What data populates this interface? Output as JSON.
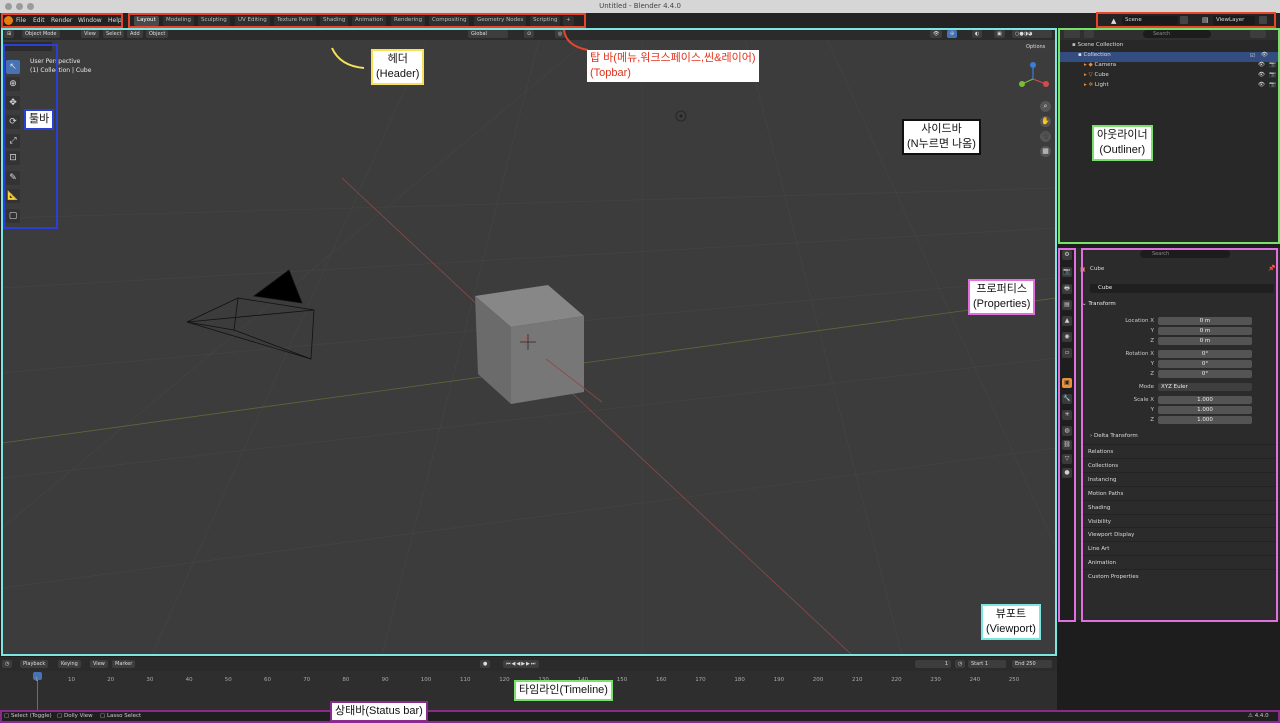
{
  "window": {
    "title": "Untitled - Blender 4.4.0"
  },
  "topbar": {
    "menus": [
      "File",
      "Edit",
      "Render",
      "Window",
      "Help"
    ],
    "workspaces": [
      "Layout",
      "Modeling",
      "Sculpting",
      "UV Editing",
      "Texture Paint",
      "Shading",
      "Animation",
      "Rendering",
      "Compositing",
      "Geometry Nodes",
      "Scripting"
    ],
    "add_tab": "+",
    "scene": "Scene",
    "view_layer": "ViewLayer"
  },
  "viewport_header": {
    "mode": "Object Mode",
    "menus": [
      "View",
      "Select",
      "Add",
      "Object"
    ],
    "orientation": "Global",
    "options": "Options"
  },
  "viewport": {
    "perspective": "User Perspective",
    "collection_info": "(1) Collection | Cube"
  },
  "annotations": {
    "header": "헤더\n(Header)",
    "topbar": "탑 바(메뉴,워크스페이스,씬&레이어)\n(Topbar)",
    "toolbar": "툴바",
    "sidebar": "사이드바\n(N누르면 나옴)",
    "outliner": "아웃라이너\n(Outliner)",
    "properties": "프로퍼티스\n(Properties)",
    "viewport": "뷰포트\n(Viewport)",
    "timeline": "타임라인(Timeline)",
    "statusbar": "상태바(Status bar)"
  },
  "outliner": {
    "search_placeholder": "Search",
    "root": "Scene Collection",
    "collection": "Collection",
    "items": [
      "Camera",
      "Cube",
      "Light"
    ]
  },
  "properties": {
    "search_placeholder": "Search",
    "object_name": "Cube",
    "object_field": "Cube",
    "transform_title": "Transform",
    "location_label": "Location X",
    "rotation_label": "Rotation X",
    "scale_label": "Scale X",
    "mode_label": "Mode",
    "location": [
      "0 m",
      "0 m",
      "0 m"
    ],
    "rotation": [
      "0°",
      "0°",
      "0°"
    ],
    "mode_value": "XYZ Euler",
    "scale": [
      "1.000",
      "1.000",
      "1.000"
    ],
    "axis_y": "Y",
    "axis_z": "Z",
    "delta": "Delta Transform",
    "panels": [
      "Relations",
      "Collections",
      "Instancing",
      "Motion Paths",
      "Shading",
      "Visibility",
      "Viewport Display",
      "Line Art",
      "Animation",
      "Custom Properties"
    ]
  },
  "timeline": {
    "playback": "Playback",
    "keying": "Keying",
    "view": "View",
    "marker": "Marker",
    "current_frame": "1",
    "start_label": "Start",
    "start": "1",
    "end_label": "End",
    "end": "250",
    "ticks": [
      "1",
      "10",
      "20",
      "30",
      "40",
      "50",
      "60",
      "70",
      "80",
      "90",
      "100",
      "110",
      "120",
      "130",
      "140",
      "150",
      "160",
      "170",
      "180",
      "190",
      "200",
      "210",
      "220",
      "230",
      "240",
      "250"
    ]
  },
  "statusbar": {
    "hints": [
      "Select (Toggle)",
      "Dolly View",
      "Lasso Select"
    ],
    "version": "4.4.0"
  },
  "colors": {
    "topbar_frame": "#e8452c",
    "header_arrow": "#f5e15a",
    "toolbar_frame": "#2a3fd6",
    "outliner_frame": "#79e06a",
    "properties_frame": "#e070e0",
    "viewport_frame": "#7ee6e0",
    "statusbar_frame": "#8a2a8a",
    "accent": "#4772b3"
  }
}
